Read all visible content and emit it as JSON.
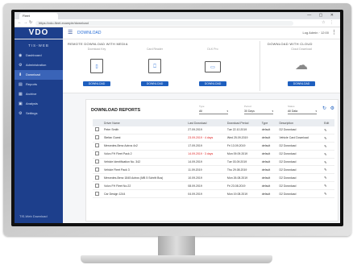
{
  "browser": {
    "tab_title": "Fleet",
    "url": "https://vdo-fleet.example/download",
    "window_controls": "— ▢ ✕",
    "ext_icons": "☆ ⋮"
  },
  "header": {
    "logo": "VDO",
    "title": "DOWNLOAD",
    "user": "Log Admin · 12:00",
    "menu_icon": "☰",
    "more_icon": "⋮"
  },
  "sidebar": {
    "heading": "TIS-WEB",
    "items": [
      {
        "label": "Dashboard",
        "icon": "◉"
      },
      {
        "label": "Administration",
        "icon": "⚙"
      },
      {
        "label": "Download",
        "icon": "⬇"
      },
      {
        "label": "Reports",
        "icon": "▤"
      },
      {
        "label": "Archive",
        "icon": "▦"
      },
      {
        "label": "Analysis",
        "icon": "▣"
      },
      {
        "label": "Settings",
        "icon": "⚙"
      }
    ],
    "active_index": 2,
    "footer": "TIS-Web Download"
  },
  "cards": {
    "left_section": "REMOTE DOWNLOAD WITH MEDIA",
    "right_section": "DOWNLOAD WITH CLOUD",
    "items": [
      {
        "label": "Download Key",
        "icon": "▯",
        "button": "DOWNLOAD"
      },
      {
        "label": "Card Reader",
        "icon": "⎕",
        "button": "DOWNLOAD"
      },
      {
        "label": "DLK Pro",
        "icon": "▭",
        "button": "DOWNLOAD"
      },
      {
        "label": "Cloud Download",
        "icon": "☁",
        "button": "DOWNLOAD"
      }
    ]
  },
  "table_panel": {
    "title": "DOWNLOAD REPORTS",
    "filters": [
      {
        "label": "Type",
        "value": "All"
      },
      {
        "label": "Period",
        "value": "30 Days"
      },
      {
        "label": "Status",
        "value": "All Data"
      }
    ],
    "refresh_icon": "↻",
    "settings_icon": "⚙",
    "columns": [
      "Driver Name",
      "Last Download",
      "Download Period",
      "Type",
      "Description",
      "Edit"
    ],
    "rows": [
      {
        "name": "Peter Smith",
        "last": "27.09.2019",
        "last_alert": false,
        "period": "Tue 22.10.2019",
        "type": "default",
        "desc": "D2 Download"
      },
      {
        "name": "Stefan Guest",
        "last": "23.09.2019 · 4 days",
        "last_alert": true,
        "period": "Wed 25.09.2019",
        "type": "default",
        "desc": "Vehicle Card Download"
      },
      {
        "name": "Mercedes-Benz Actros 4x2",
        "last": "17.09.2019",
        "last_alert": false,
        "period": "Fri 13.09.2019",
        "type": "default",
        "desc": "D2 Download"
      },
      {
        "name": "Volvo FH Fleet Pack 2",
        "last": "14.09.2019 · 3 days",
        "last_alert": true,
        "period": "Mon 09.09.2019",
        "type": "default",
        "desc": "D2 Download"
      },
      {
        "name": "Vehicle Identification No. 342",
        "last": "14.09.2019",
        "last_alert": false,
        "period": "Tue 03.09.2019",
        "type": "default",
        "desc": "D2 Download"
      },
      {
        "name": "Vehicle Fleet Pack 3",
        "last": "11.09.2019",
        "last_alert": false,
        "period": "Thu 29.08.2019",
        "type": "default",
        "desc": "D2 Download"
      },
      {
        "name": "Mercedes-Benz 1845 Actros (MB 5 Schritt Bus)",
        "last": "10.09.2019",
        "last_alert": false,
        "period": "Mon 26.08.2019",
        "type": "default",
        "desc": "D2 Download"
      },
      {
        "name": "Volvo FH Fleet No.22",
        "last": "08.09.2019",
        "last_alert": false,
        "period": "Fri 23.08.2019",
        "type": "default",
        "desc": "D2 Download"
      },
      {
        "name": "Car Design 1244",
        "last": "04.09.2019",
        "last_alert": false,
        "period": "Mon 19.08.2019",
        "type": "default",
        "desc": "D2 Download"
      }
    ]
  }
}
